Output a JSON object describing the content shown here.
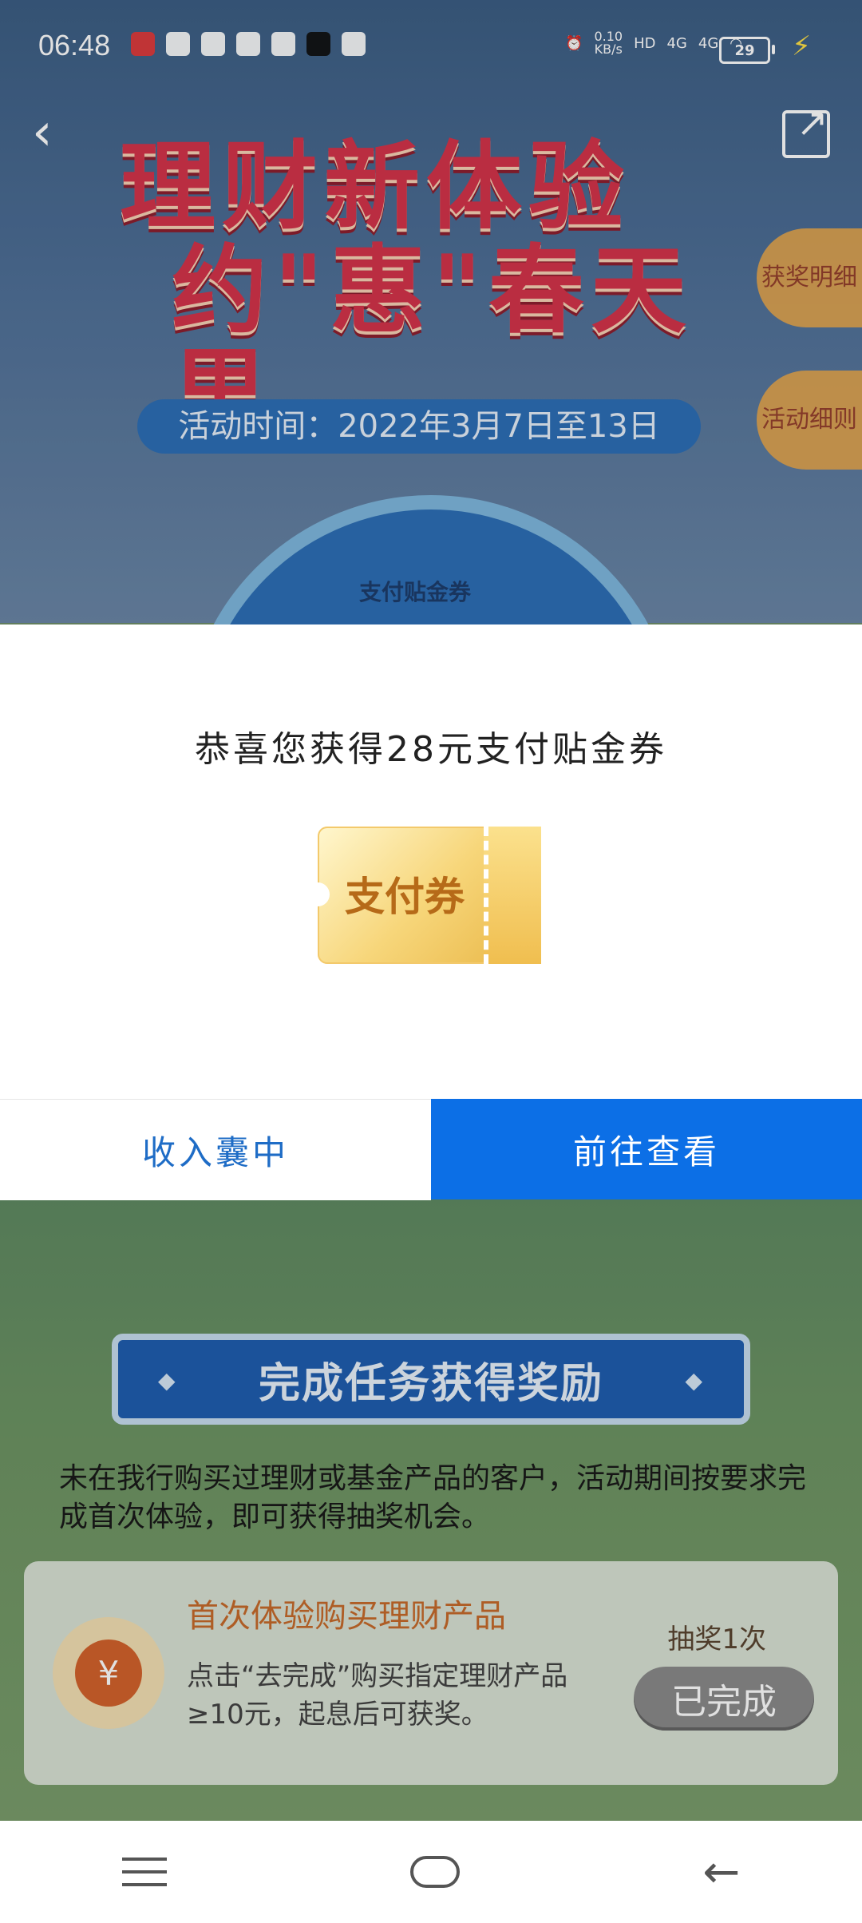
{
  "status_bar": {
    "time": "06:48",
    "speed_value": "0.10",
    "speed_unit": "KB/s",
    "network": "4G",
    "battery": "29"
  },
  "header": {
    "title_line1": "理财新体验",
    "title_line2": "约\"惠\"春天里",
    "activity_time": "活动时间：2022年3月7日至13日",
    "side_tabs": [
      "获奖明细",
      "活动细则"
    ],
    "wheel_label": "支付贴金券"
  },
  "modal": {
    "title": "恭喜您获得28元支付贴金券",
    "ticket_label": "支付券",
    "buttons": {
      "left": "收入囊中",
      "right": "前往查看"
    }
  },
  "tasks": {
    "banner": "完成任务获得奖励",
    "description": "未在我行购买过理财或基金产品的客户，活动期间按要求完成首次体验，即可获得抽奖机会。",
    "card": {
      "title": "首次体验购买理财产品",
      "text": "点击“去完成”购买指定理财产品≥10元，起息后可获奖。",
      "count": "抽奖1次",
      "status": "已完成"
    }
  }
}
